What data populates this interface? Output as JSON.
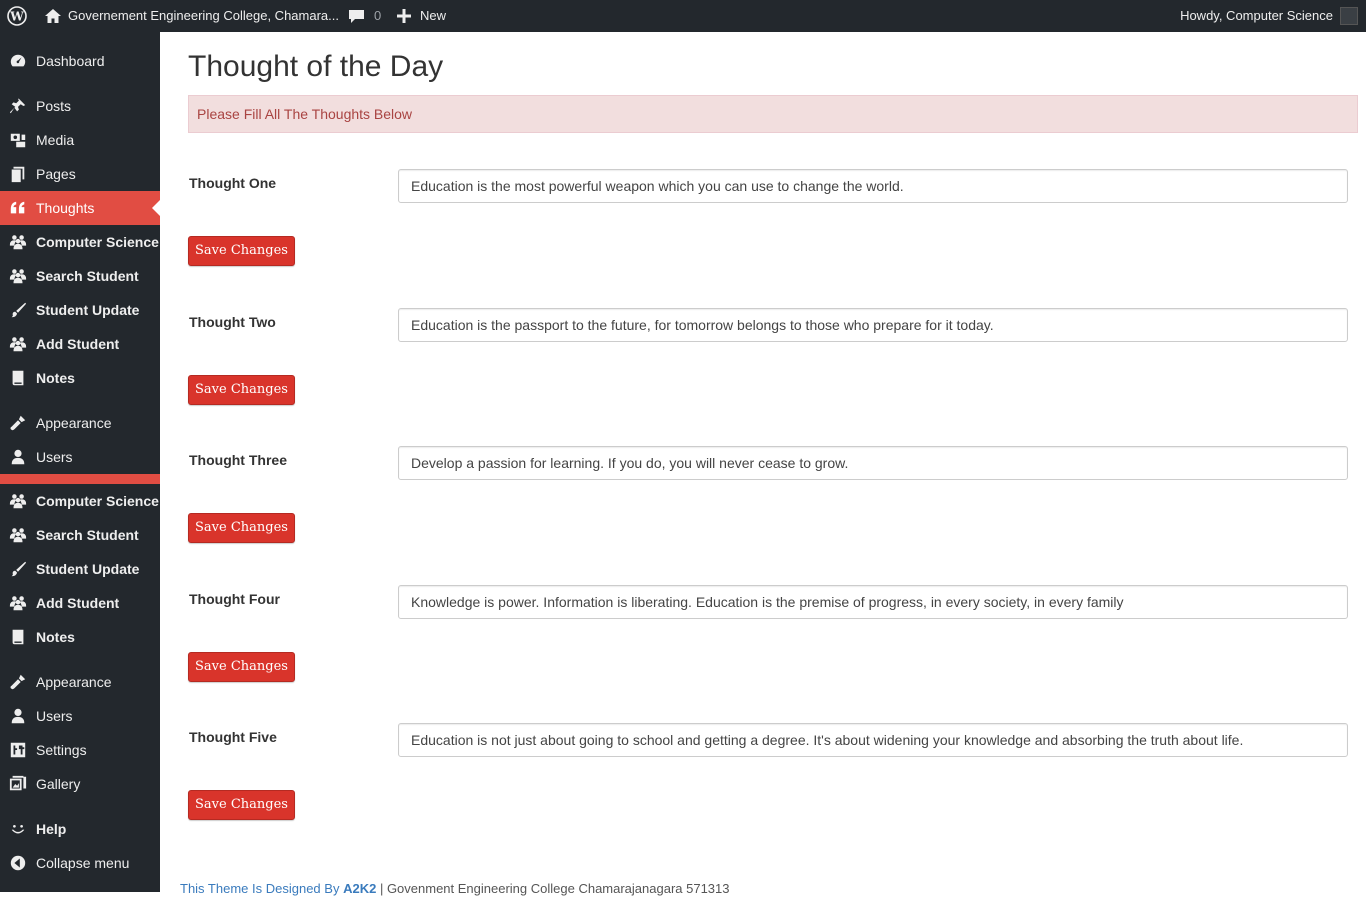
{
  "adminbar": {
    "site_name": "Governement Engineering College, Chamara...",
    "comments_count": "0",
    "new_label": "New",
    "howdy": "Howdy, Computer Science"
  },
  "sidebar": {
    "items": [
      {
        "label": "Dashboard",
        "icon": "dashboard-icon"
      },
      {
        "label": "Posts",
        "icon": "pin-icon"
      },
      {
        "label": "Media",
        "icon": "media-icon"
      },
      {
        "label": "Pages",
        "icon": "pages-icon"
      },
      {
        "label": "Thoughts",
        "icon": "quote-icon"
      },
      {
        "label": "Computer Science",
        "icon": "group-icon"
      },
      {
        "label": "Search Student",
        "icon": "group-icon"
      },
      {
        "label": "Student Update",
        "icon": "brush-icon"
      },
      {
        "label": "Add Student",
        "icon": "group-icon"
      },
      {
        "label": "Notes",
        "icon": "book-icon"
      },
      {
        "label": "Appearance",
        "icon": "appearance-icon"
      },
      {
        "label": "Users",
        "icon": "user-icon"
      },
      {
        "label": "Computer Science",
        "icon": "group-icon"
      },
      {
        "label": "Search Student",
        "icon": "group-icon"
      },
      {
        "label": "Student Update",
        "icon": "brush-icon"
      },
      {
        "label": "Add Student",
        "icon": "group-icon"
      },
      {
        "label": "Notes",
        "icon": "book-icon"
      },
      {
        "label": "Appearance",
        "icon": "appearance-icon"
      },
      {
        "label": "Users",
        "icon": "user-icon"
      },
      {
        "label": "Settings",
        "icon": "settings-icon"
      },
      {
        "label": "Gallery",
        "icon": "gallery-icon"
      },
      {
        "label": "Help",
        "icon": "smile-icon"
      },
      {
        "label": "Collapse menu",
        "icon": "collapse-icon"
      }
    ]
  },
  "main": {
    "title": "Thought of the Day",
    "alert": "Please Fill All The Thoughts Below",
    "save_label": "Save Changes",
    "thoughts": [
      {
        "label": "Thought One",
        "value": "Education is the most powerful weapon which you can use to change the world."
      },
      {
        "label": "Thought Two",
        "value": "Education is the passport to the future, for tomorrow belongs to those who prepare for it today."
      },
      {
        "label": "Thought Three",
        "value": "Develop a passion for learning. If you do, you will never cease to grow."
      },
      {
        "label": "Thought Four",
        "value": "Knowledge is power. Information is liberating. Education is the premise of progress, in every society, in every family"
      },
      {
        "label": "Thought Five",
        "value": "Education is not just about going to school and getting a degree. It's about widening your knowledge and absorbing the truth about life."
      }
    ]
  },
  "footer": {
    "designed_by": "This Theme Is Designed By",
    "brand": "A2K2",
    "separator": " | ",
    "college": "Govenment Engineering College Chamarajanagara 571313"
  }
}
